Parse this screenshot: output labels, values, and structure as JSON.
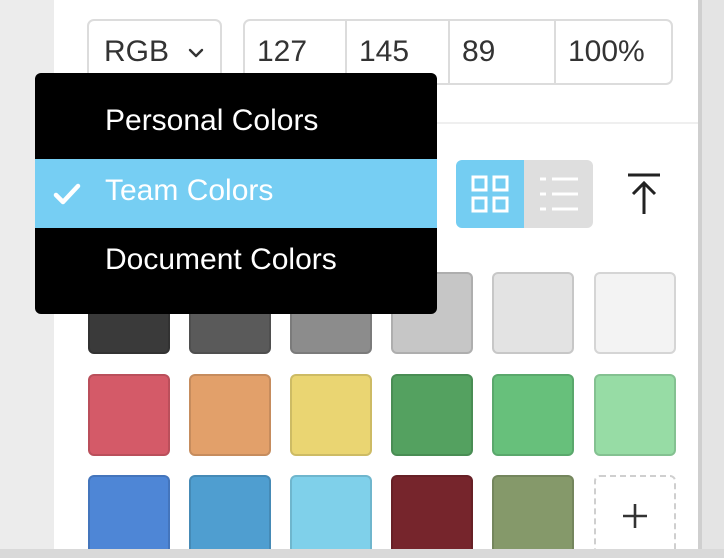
{
  "color_input": {
    "mode": "RGB",
    "values": [
      "127",
      "145",
      "89",
      "100%"
    ]
  },
  "library_menu": {
    "items": [
      {
        "label": "Personal Colors",
        "selected": false
      },
      {
        "label": "Team Colors",
        "selected": true
      },
      {
        "label": "Document Colors",
        "selected": false
      }
    ]
  },
  "view_toggle": {
    "active": "grid",
    "options": [
      "grid",
      "list"
    ]
  },
  "icons": {
    "mode_chevron": "chevron-down-icon",
    "grid_view": "grid-view-icon",
    "list_view": "list-view-icon",
    "upload": "upload-icon",
    "check": "check-icon",
    "add": "plus-icon"
  },
  "swatches": [
    [
      "#3a3a3a",
      "#5a5a5a",
      "#8c8c8c",
      "#c6c6c6",
      "#e3e3e3",
      "#f3f3f3"
    ],
    [
      "#d45a68",
      "#e2a06a",
      "#ead572",
      "#54a160",
      "#67c07b",
      "#97dca5"
    ],
    [
      "#4e86d6",
      "#4f9ed0",
      "#7fd0ea",
      "#76252c",
      "#85996a"
    ]
  ]
}
